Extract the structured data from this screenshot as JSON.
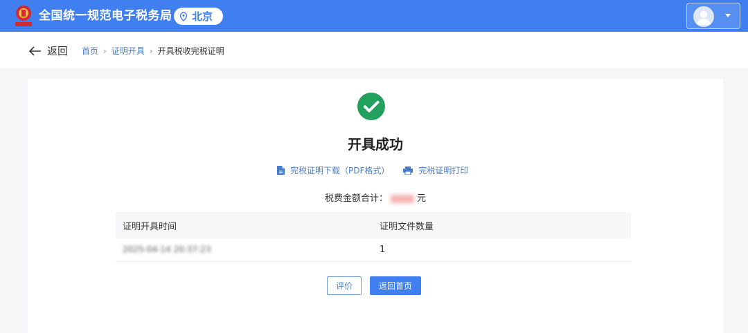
{
  "header": {
    "brand": "全国统一规范电子税务局",
    "region": "北京",
    "colors": {
      "accent": "#3f7ff0",
      "success": "#22a15e"
    }
  },
  "nav": {
    "back_label": "返回",
    "breadcrumb": [
      "首页",
      "证明开具",
      "开具税收完税证明"
    ]
  },
  "result": {
    "title": "开具成功",
    "download_label": "完税证明下载（PDF格式）",
    "print_label": "完税证明打印",
    "total_label": "税费金额合计：",
    "total_value": "23.81",
    "currency": "元"
  },
  "table": {
    "headers": [
      "证明开具时间",
      "证明文件数量"
    ],
    "rows": [
      [
        "2025-04-14 20:37:23",
        "1"
      ]
    ]
  },
  "actions": {
    "rate_label": "评价",
    "home_label": "返回首页"
  }
}
